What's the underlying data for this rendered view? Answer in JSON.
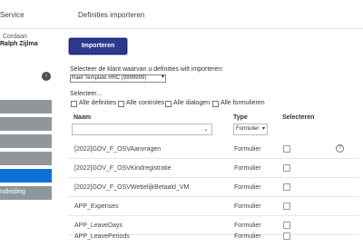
{
  "topbar": {
    "tab1": "Service",
    "tab2": "Definities importeren"
  },
  "sidebar": {
    "user_line1": "Cordaan",
    "user_line2": "Ralph Zijlma",
    "collapse_icon": "chevron-left-icon",
    "items": [
      {
        "label": ""
      },
      {
        "label": ""
      },
      {
        "label": ""
      },
      {
        "label": ""
      },
      {
        "label": ""
      },
      {
        "label": "ndleiding"
      }
    ]
  },
  "main": {
    "import_button": "Importeren",
    "client_label": "Selecteer de klant waarvan u definities wilt importeren:",
    "client_value": "Raet Template HRC (9999999)",
    "select_label": "Selecteer...",
    "checks": [
      "Alle definities",
      "Alle controles",
      "Alle dialogen",
      "Alle formulieren"
    ],
    "columns": {
      "name": "Naam",
      "type": "Type",
      "select": "Selecteren"
    },
    "type_filter": "Formulier",
    "rows": [
      {
        "name": "[2022]GOV_F_OSVAanvragen",
        "type": "Formulier"
      },
      {
        "name": "[2022]GOV_F_OSVKindregistratie",
        "type": "Formulier"
      },
      {
        "name": "[2022]GOV_F_OSVWettelijkBetaald_VM",
        "type": "Formulier"
      },
      {
        "name": "APP_Expenses",
        "type": "Formulier"
      },
      {
        "name": "APP_LeaveDays",
        "type": "Formulier"
      },
      {
        "name": "APP_LeavePeriods",
        "type": "Formulier"
      }
    ],
    "help_icon": "question-circle-icon"
  }
}
